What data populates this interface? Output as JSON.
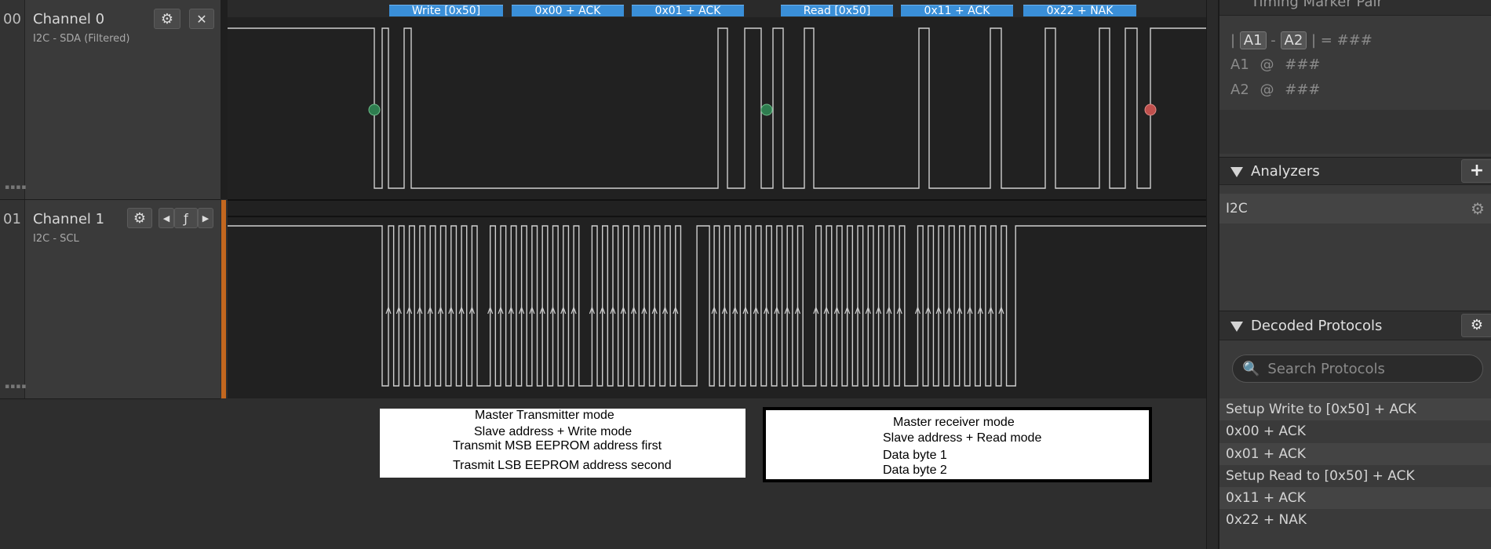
{
  "channels": [
    {
      "num": "00",
      "name": "Channel 0",
      "sub": "I2C - SDA (Filtered)"
    },
    {
      "num": "01",
      "name": "Channel 1",
      "sub": "I2C - SCL"
    }
  ],
  "bubbles": [
    "Write [0x50]",
    "0x00 + ACK",
    "0x01 + ACK",
    "Read [0x50]",
    "0x11 + ACK",
    "0x22 + NAK"
  ],
  "timing": {
    "title": "Timing Marker Pair",
    "diff_label": "= ###",
    "a1_label": "A1",
    "a2_label": "A2",
    "a1_at": "@",
    "a1_val": "###",
    "a2_at": "@",
    "a2_val": "###"
  },
  "analyzers": {
    "title": "Analyzers",
    "add": "+",
    "items": [
      "I2C"
    ]
  },
  "decoded": {
    "title": "Decoded Protocols",
    "search_placeholder": "Search Protocols",
    "rows": [
      "Setup Write to [0x50] + ACK",
      "0x00 + ACK",
      "0x01 + ACK",
      "Setup Read to [0x50] + ACK",
      "0x11 + ACK",
      "0x22 + NAK"
    ]
  },
  "notes": {
    "left": [
      "Master Transmitter mode",
      "Slave address + Write mode",
      "Transmit MSB EEPROM address first",
      "Trasmit LSB EEPROM address second"
    ],
    "right": [
      "Master receiver mode",
      "Slave address + Read mode",
      "Data byte 1",
      "Data byte 2"
    ]
  },
  "colors": {
    "bubble": "#3a8fd8",
    "start_marker": "#2e7d4f",
    "stop_marker": "#c0504d",
    "trace": "#cfcfcf",
    "channel1_accent": "#c2671f"
  },
  "icons": [
    "gear-icon",
    "close-icon",
    "triangle-left-icon",
    "edge-trigger-icon",
    "triangle-right-icon",
    "search-icon",
    "plus-icon",
    "collapse-triangle-icon"
  ]
}
